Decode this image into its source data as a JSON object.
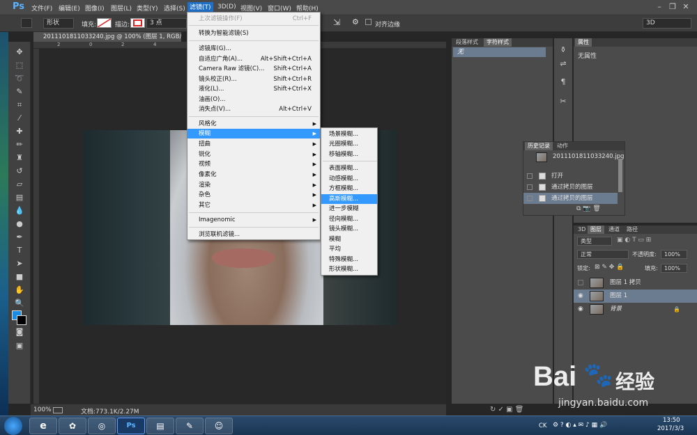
{
  "app": {
    "logo": "Ps"
  },
  "menubar": {
    "items": [
      "文件(F)",
      "编辑(E)",
      "图像(I)",
      "图层(L)",
      "类型(Y)",
      "选择(S)",
      "滤镜(T)",
      "3D(D)",
      "视图(V)",
      "窗口(W)",
      "帮助(H)"
    ],
    "active": "滤镜(T)"
  },
  "options": {
    "shape_mode": "形状",
    "fill_label": "填充:",
    "stroke_label": "描边:",
    "stroke_width": "3 点",
    "align_label": "对齐边缘",
    "mode_3d": "3D"
  },
  "document": {
    "tab_title": "20111018110332​40.jpg @ 100% (图层 1, RGB/8#) *",
    "zoom": "100%",
    "doc_info": "文档:773.1K/2.27M"
  },
  "ruler": {
    "h_ticks": [
      "2",
      "0",
      "2",
      "4",
      "6",
      "8",
      "10",
      "12",
      "14",
      "16",
      "18",
      "20",
      "22"
    ]
  },
  "filter_menu": {
    "items": [
      {
        "label": "上次滤镜操作(F)",
        "shortcut": "Ctrl+F",
        "disabled": true
      },
      {
        "label": "转换为智能滤镜(S)",
        "shortcut": ""
      },
      {
        "label": "滤镜库(G)...",
        "shortcut": ""
      },
      {
        "label": "自适应广角(A)...",
        "shortcut": "Alt+Shift+Ctrl+A"
      },
      {
        "label": "Camera Raw 滤镜(C)...",
        "shortcut": "Shift+Ctrl+A"
      },
      {
        "label": "镜头校正(R)...",
        "shortcut": "Shift+Ctrl+R"
      },
      {
        "label": "液化(L)...",
        "shortcut": "Shift+Ctrl+X"
      },
      {
        "label": "油画(O)...",
        "shortcut": ""
      },
      {
        "label": "消失点(V)...",
        "shortcut": "Alt+Ctrl+V"
      },
      {
        "label": "风格化",
        "shortcut": "",
        "submenu": true
      },
      {
        "label": "模糊",
        "shortcut": "",
        "submenu": true,
        "highlighted": true
      },
      {
        "label": "扭曲",
        "shortcut": "",
        "submenu": true
      },
      {
        "label": "锐化",
        "shortcut": "",
        "submenu": true
      },
      {
        "label": "视频",
        "shortcut": "",
        "submenu": true
      },
      {
        "label": "像素化",
        "shortcut": "",
        "submenu": true
      },
      {
        "label": "渲染",
        "shortcut": "",
        "submenu": true
      },
      {
        "label": "杂色",
        "shortcut": "",
        "submenu": true
      },
      {
        "label": "其它",
        "shortcut": "",
        "submenu": true
      },
      {
        "label": "Imagenomic",
        "shortcut": "",
        "submenu": true
      },
      {
        "label": "浏览联机滤镜...",
        "shortcut": ""
      }
    ]
  },
  "blur_menu": {
    "items": [
      "场景模糊...",
      "光圈模糊...",
      "移轴模糊...",
      "表面模糊...",
      "动感模糊...",
      "方框模糊...",
      "高斯模糊...",
      "进一步模糊",
      "径向模糊...",
      "镜头模糊...",
      "模糊",
      "平均",
      "特殊模糊...",
      "形状模糊..."
    ],
    "highlighted": "高斯模糊..."
  },
  "panels": {
    "para_tabs": [
      "段落样式",
      "字符样式"
    ],
    "para_selected": "无",
    "props_title": "属性",
    "props_empty": "无属性",
    "history_tabs": [
      "历史记录",
      "动作"
    ],
    "history_snapshot": "20111018110332​40.jpg",
    "history_items": [
      "打开",
      "通过拷贝的图层",
      "通过拷贝的图层"
    ],
    "layers_tabs": [
      "3D",
      "图层",
      "通道",
      "路径"
    ],
    "layer_filter": "类型",
    "blend_mode": "正常",
    "opacity_label": "不透明度:",
    "opacity_value": "100%",
    "lock_label": "锁定:",
    "fill_label": "填充:",
    "fill_value": "100%",
    "layers": [
      {
        "name": "图层 1 拷贝",
        "visible": false,
        "selected": false
      },
      {
        "name": "图层 1",
        "visible": true,
        "selected": true
      },
      {
        "name": "背景",
        "visible": true,
        "selected": false,
        "italic": true
      }
    ]
  },
  "taskbar": {
    "lang": "CK",
    "time": "13:50",
    "date": "2017/3/3"
  },
  "watermark": {
    "brand": "Bai",
    "brand2": "经验",
    "url": "jingyan.baidu.com"
  },
  "colors": {
    "accent": "#3399ff",
    "fg": "#1a8ce6",
    "bg": "#000000"
  }
}
